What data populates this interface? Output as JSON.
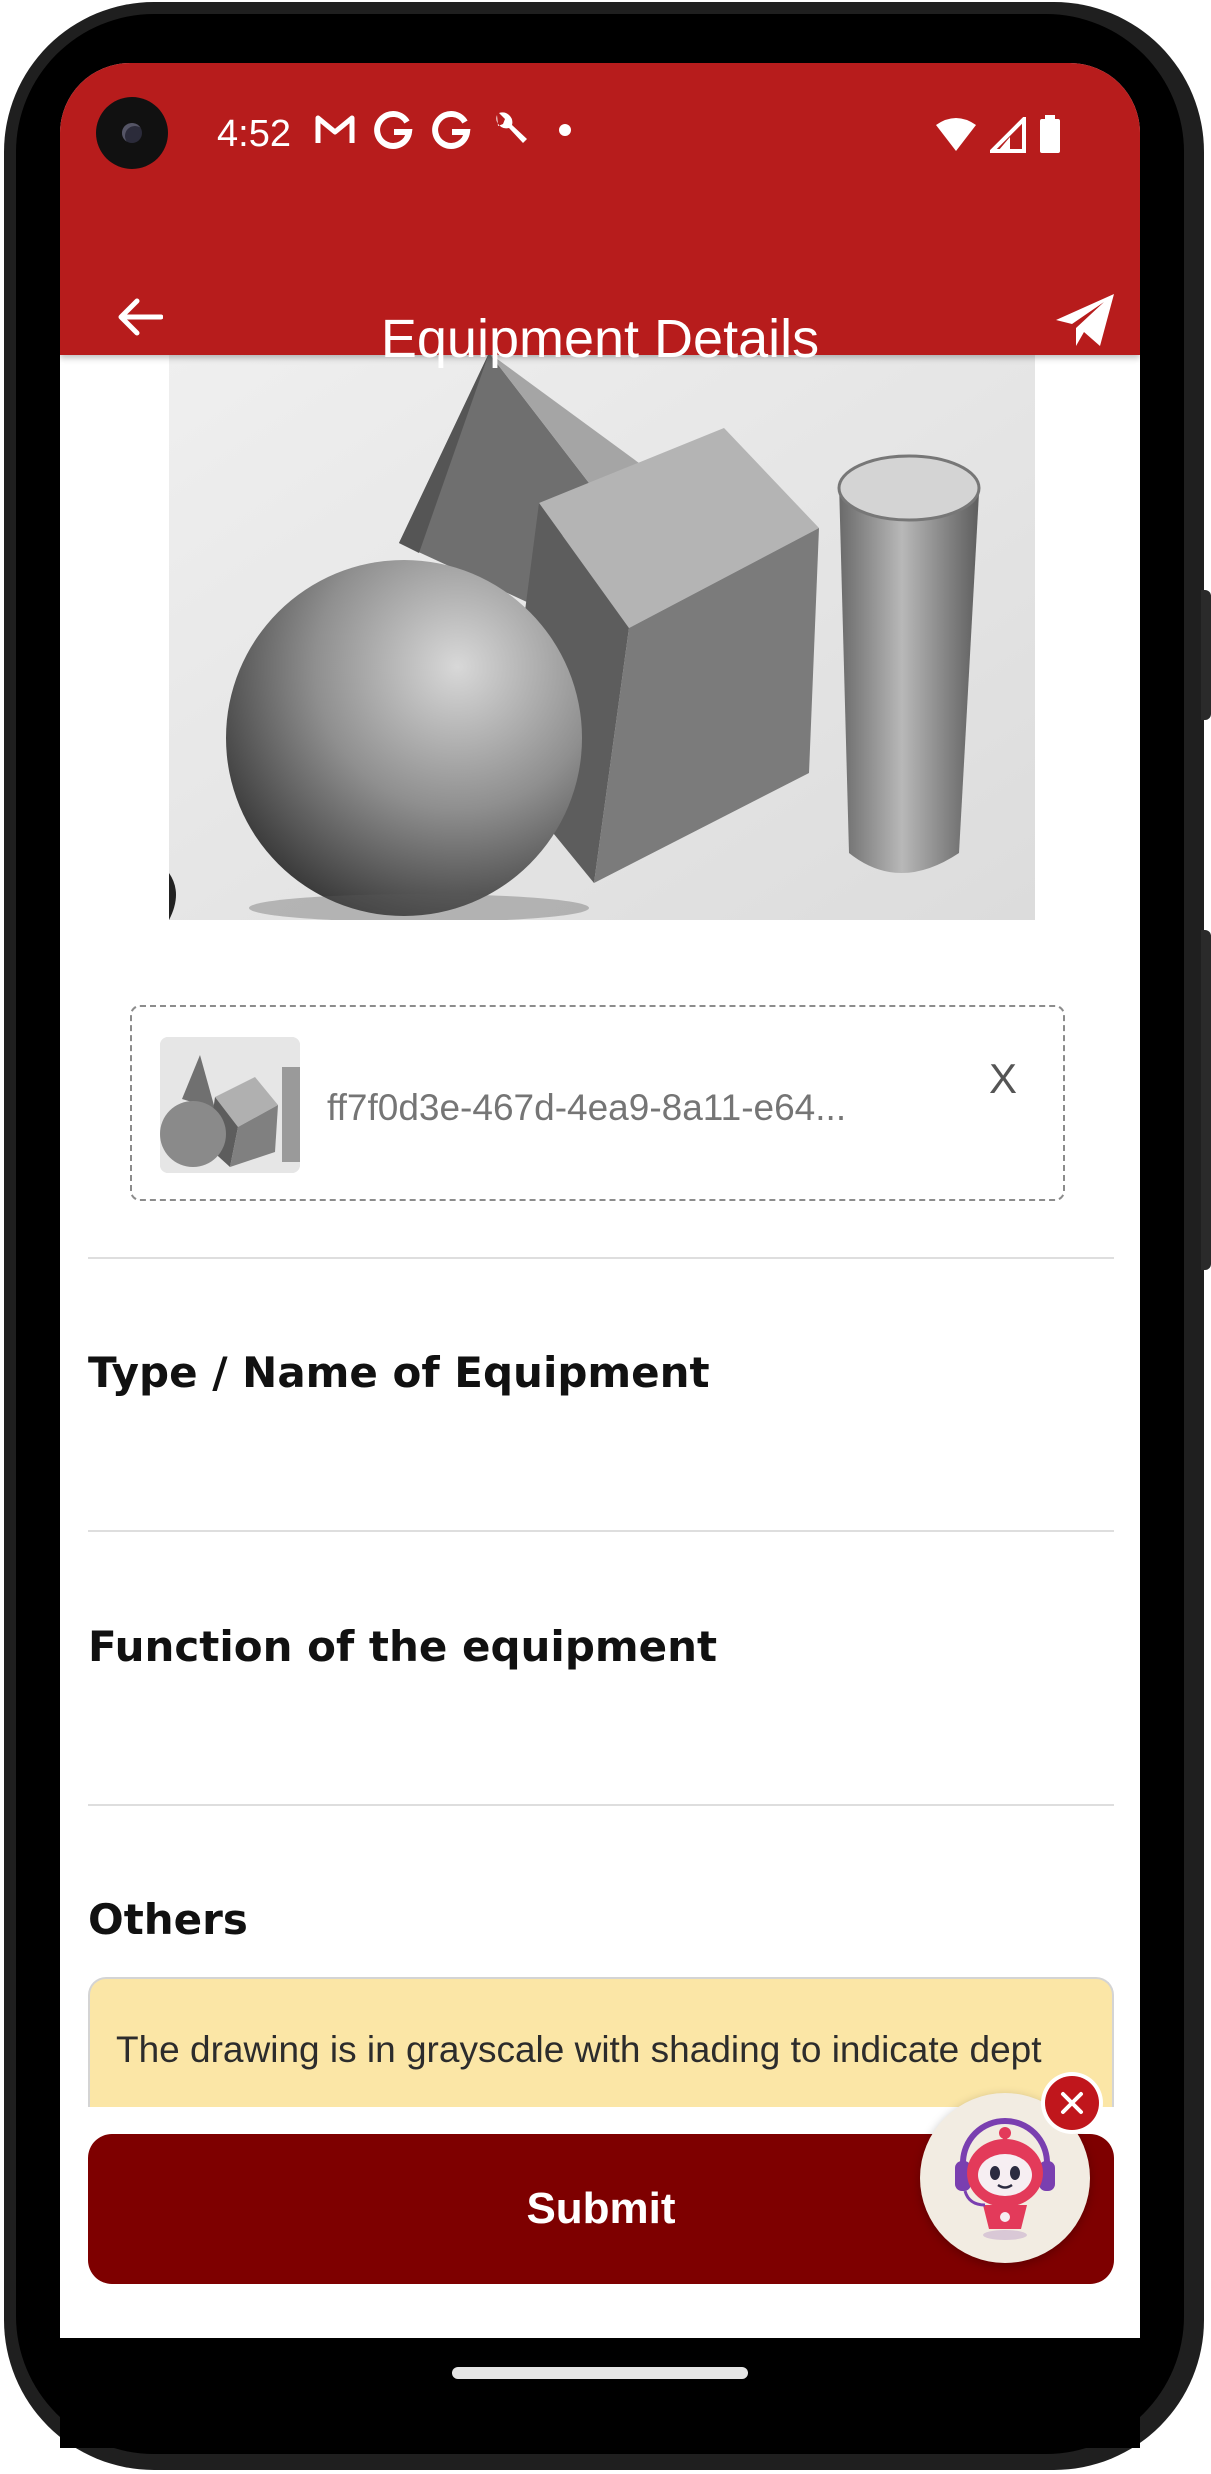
{
  "status_bar": {
    "time": "4:52",
    "left_icons": [
      "gmail-icon",
      "google-icon",
      "google-icon",
      "wrench-icon",
      "dot-icon"
    ],
    "right_icons": [
      "wifi-icon",
      "signal-icon",
      "battery-icon"
    ]
  },
  "toolbar": {
    "title": "Equipment Details",
    "back_icon": "arrow-left-icon",
    "send_icon": "paper-plane-icon",
    "color": "#b71c1c"
  },
  "attachment": {
    "file_name": "ff7f0d3e-467d-4ea9-8a11-e64...",
    "remove_label": "X"
  },
  "fields": {
    "type_name_label": "Type / Name of Equipment",
    "function_label": "Function of the equipment",
    "others_label": "Others",
    "others_value": "The drawing is in grayscale with shading to indicate dept"
  },
  "submit": {
    "label": "Submit",
    "color": "#7e0000"
  },
  "assistant": {
    "icon": "robot-assistant-icon",
    "close_icon": "close-icon"
  }
}
